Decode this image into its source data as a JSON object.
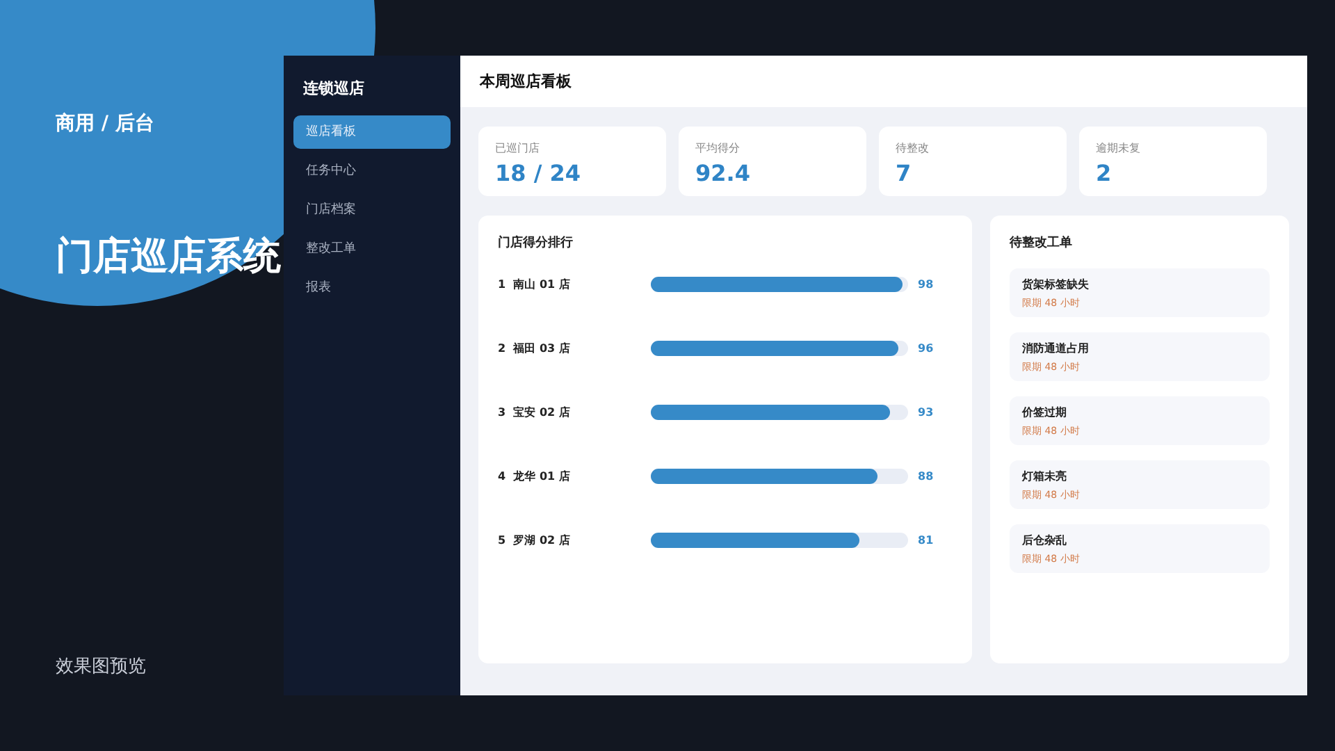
{
  "intro": {
    "eyebrow": "商用 / 后台",
    "title": "门店巡店系统",
    "caption": "效果图预览"
  },
  "sidebar": {
    "brand": "连锁巡店",
    "items": [
      {
        "label": "巡店看板",
        "selected": true
      },
      {
        "label": "任务中心",
        "selected": false
      },
      {
        "label": "门店档案",
        "selected": false
      },
      {
        "label": "整改工单",
        "selected": false
      },
      {
        "label": "报表",
        "selected": false
      }
    ]
  },
  "header": {
    "title": "本周巡店看板"
  },
  "stats": [
    {
      "label": "已巡门店",
      "value": "18 / 24"
    },
    {
      "label": "平均得分",
      "value": "92.4"
    },
    {
      "label": "待整改",
      "value": "7"
    },
    {
      "label": "逾期未复",
      "value": "2"
    }
  ],
  "ranking": {
    "title": "门店得分排行",
    "rows": [
      {
        "rank": "1",
        "store": "南山 01 店",
        "level": 0.98,
        "score": "98"
      },
      {
        "rank": "2",
        "store": "福田 03 店",
        "level": 0.96,
        "score": "96"
      },
      {
        "rank": "3",
        "store": "宝安 02 店",
        "level": 0.93,
        "score": "93"
      },
      {
        "rank": "4",
        "store": "龙华 01 店",
        "level": 0.88,
        "score": "88"
      },
      {
        "rank": "5",
        "store": "罗湖 02 店",
        "level": 0.81,
        "score": "81"
      }
    ]
  },
  "work_orders": {
    "title": "待整改工单",
    "items": [
      {
        "title": "货架标签缺失",
        "deadline": "限期 48 小时"
      },
      {
        "title": "消防通道占用",
        "deadline": "限期 48 小时"
      },
      {
        "title": "价签过期",
        "deadline": "限期 48 小时"
      },
      {
        "title": "灯箱未亮",
        "deadline": "限期 48 小时"
      },
      {
        "title": "后仓杂乱",
        "deadline": "限期 48 小时"
      }
    ]
  }
}
